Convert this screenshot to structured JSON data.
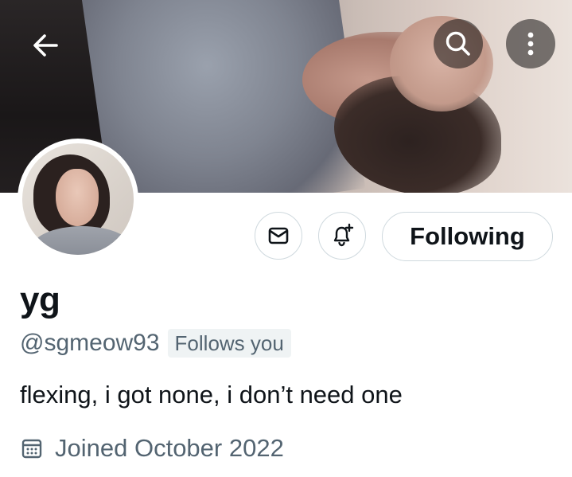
{
  "header": {
    "back_icon": "arrow-left-icon",
    "search_icon": "search-icon",
    "more_icon": "more-vertical-icon"
  },
  "profile": {
    "display_name": "yg",
    "handle": "@sgmeow93",
    "follows_you_badge": "Follows you",
    "bio": "flexing, i got none, i don’t need one",
    "joined": "Joined October 2022",
    "joined_icon": "calendar-icon"
  },
  "actions": {
    "message_icon": "envelope-icon",
    "notify_icon": "bell-plus-icon",
    "follow_label": "Following"
  },
  "colors": {
    "primary_text": "#0f1419",
    "secondary_text": "#536471",
    "border": "#cfd9de",
    "badge_bg": "#eff3f4"
  }
}
